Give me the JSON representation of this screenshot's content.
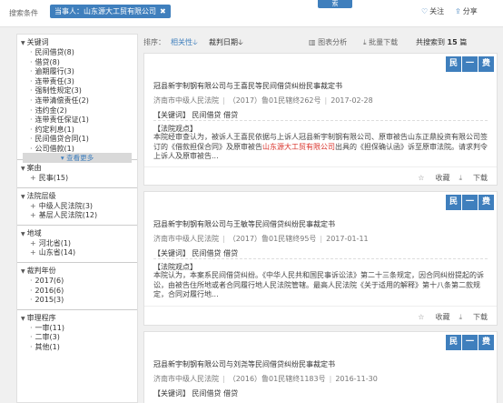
{
  "search": {
    "cond_label": "搜索条件",
    "tag_label": "当事人：山东源大工贸有限公司",
    "tag_close": "✖",
    "search_button": "索",
    "follow_label": "关注",
    "share_label": "分享",
    "follow_icon": "heart-icon",
    "share_icon": "share-icon"
  },
  "sidebar": {
    "sections": [
      {
        "title": "关键词",
        "items": [
          "民间借贷(8)",
          "借贷(8)",
          "逾期履行(3)",
          "连带责任(3)",
          "强制性规定(3)",
          "连带清偿责任(2)",
          "违约金(2)",
          "连带责任保证(1)",
          "约定利息(1)",
          "民间借贷合同(1)",
          "公司借款(1)"
        ],
        "more": "查看更多"
      },
      {
        "title": "案由",
        "items": [
          "民事(15)"
        ]
      },
      {
        "title": "法院层级",
        "items": [
          "中级人民法院(3)",
          "基层人民法院(12)"
        ]
      },
      {
        "title": "地域",
        "items": [
          "河北省(1)",
          "山东省(14)"
        ]
      },
      {
        "title": "裁判年份",
        "items": [
          "2017(6)",
          "2016(6)",
          "2015(3)"
        ]
      },
      {
        "title": "审理程序",
        "items": [
          "一审(11)",
          "二审(3)",
          "其他(1)"
        ]
      }
    ]
  },
  "sortbar": {
    "label": "排序：",
    "relevance": "相关性",
    "date": "裁判日期",
    "chart": "图表分析",
    "batch_download": "批量下载",
    "total_prefix": "共搜索到",
    "total_count": "15",
    "total_suffix": "篇"
  },
  "cards": [
    {
      "badges": [
        "民",
        "一",
        "费"
      ],
      "title": "冠县新宇制钢有限公司与王喜民等民间借贷纠纷民事裁定书",
      "court": "济南市中级人民法院",
      "case_no": "（2017）鲁01民辖终262号",
      "date": "2017-02-28",
      "keywords": "【关键词】 民间借贷   借贷",
      "point_label": "【法院观点】",
      "point_before": "本院经审查认为，被诉人王喜民依据与上诉人冠县新宇制钢有限公司、原审被告山东正鼎投资有限公司签订的《借款担保合同》及原审被告",
      "point_highlight": "山东源大工贸有限公司",
      "point_after": "出具的《担保确认函》诉至原审法院。请求判令上诉人及原审被告...",
      "collect": "收藏",
      "download": "下载"
    },
    {
      "badges": [
        "民",
        "一",
        "费"
      ],
      "title": "冠县新宇制钢有限公司与王敏等民间借贷纠纷民事裁定书",
      "court": "济南市中级人民法院",
      "case_no": "（2017）鲁01民辖终95号",
      "date": "2017-01-11",
      "keywords": "【关键词】 民间借贷   借贷",
      "point_label": "【法院观点】",
      "point_before": "本院认为，本案系民间借贷纠纷。《中华人民共和国民事诉讼法》第二十三条规定，因合同纠纷提起的诉讼，由被告住所地或者合同履行地人民法院管辖。最高人民法院《关于适用的解释》第十八条第二款规定，合同对履行地...",
      "point_highlight": "",
      "point_after": "",
      "collect": "收藏",
      "download": "下载"
    },
    {
      "badges": [
        "民",
        "一",
        "费"
      ],
      "title": "冠县新宇制钢有限公司与刘尧等民间借贷纠纷民事裁定书",
      "court": "济南市中级人民法院",
      "case_no": "（2016）鲁01民辖终1183号",
      "date": "2016-11-30",
      "keywords": "【关键词】 民间借贷   借贷"
    }
  ],
  "colors": {
    "accent": "#3f7fbd",
    "highlight": "#d9332b"
  }
}
